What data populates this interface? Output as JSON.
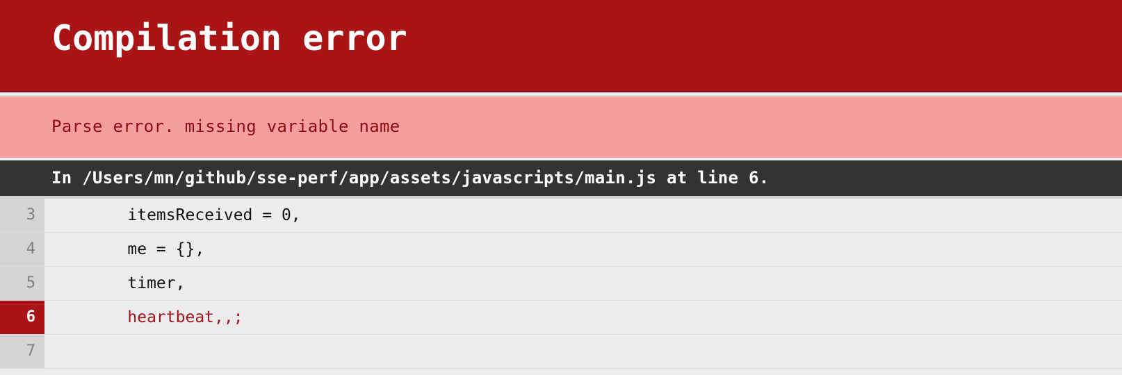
{
  "header": {
    "title": "Compilation error"
  },
  "message": {
    "text": "Parse error. missing variable name"
  },
  "location": {
    "text": "In /Users/mn/github/sse-perf/app/assets/javascripts/main.js at line 6."
  },
  "code": {
    "error_line": 6,
    "lines": [
      {
        "number": "3",
        "text": "itemsReceived = 0,"
      },
      {
        "number": "4",
        "text": "me = {},"
      },
      {
        "number": "5",
        "text": "timer,"
      },
      {
        "number": "6",
        "text": "heartbeat,,;"
      },
      {
        "number": "7",
        "text": ""
      }
    ]
  },
  "colors": {
    "header_bg": "#a91517",
    "message_bg": "#f49e9f",
    "message_text": "#8e0d11",
    "location_bg": "#333432",
    "code_bg": "#ececec",
    "gutter_bg": "#d5d5d5",
    "error_highlight": "#a91517"
  }
}
